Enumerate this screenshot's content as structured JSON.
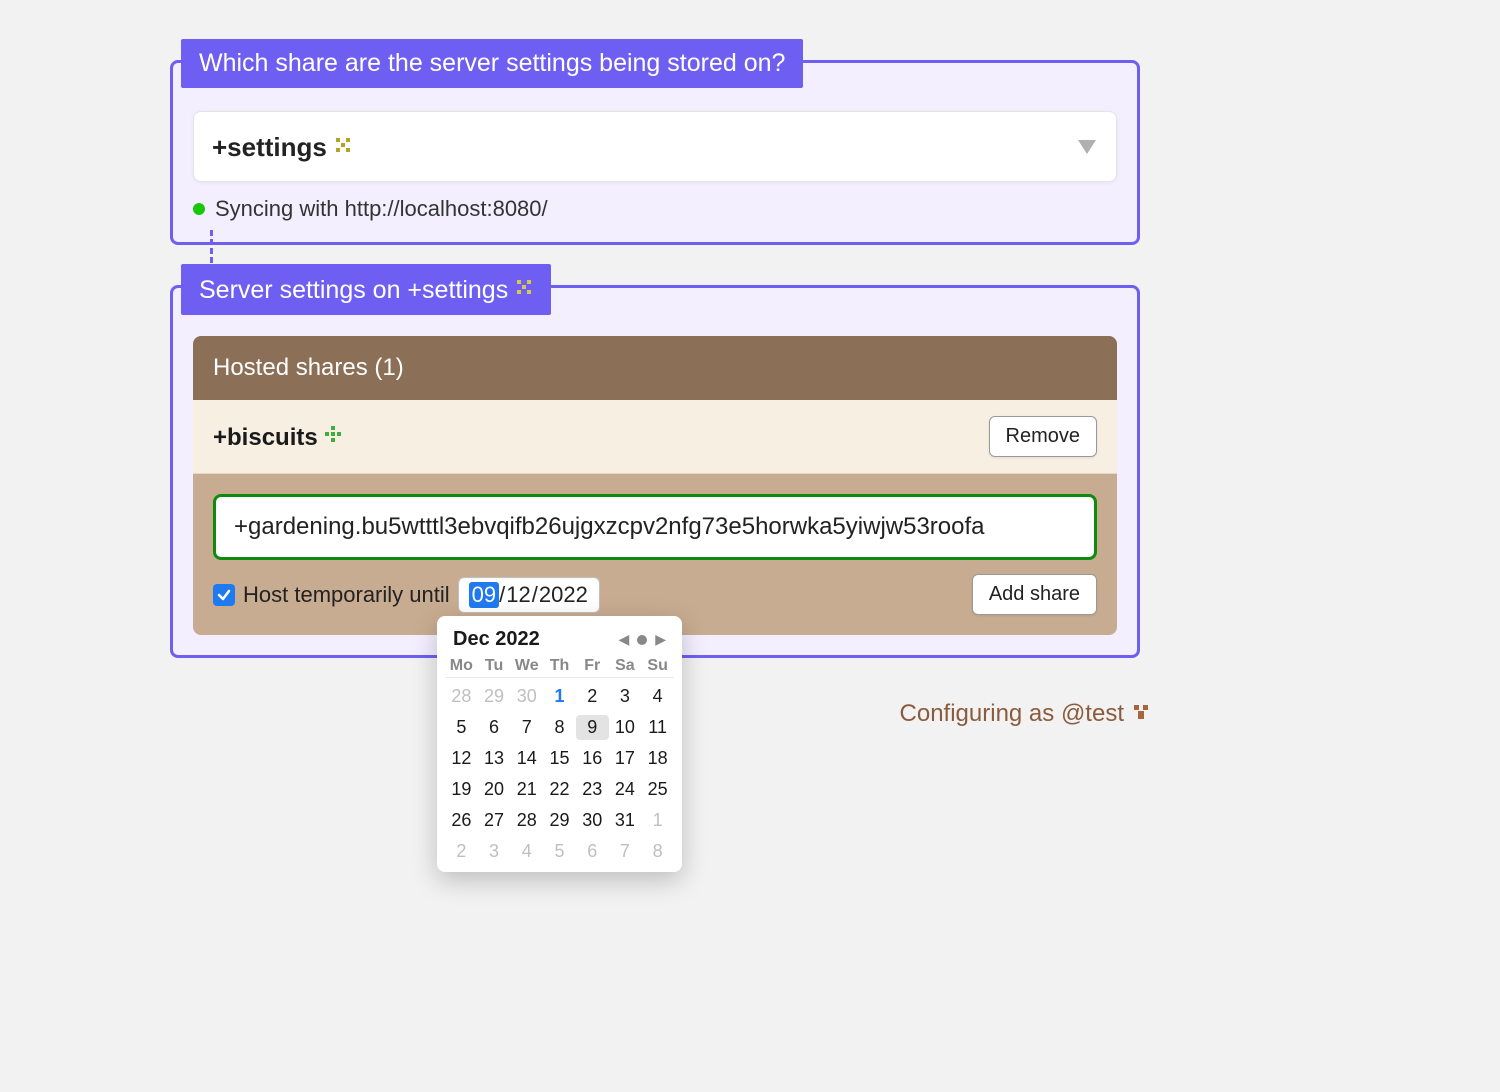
{
  "panel1": {
    "title": "Which share are the server settings being stored on?",
    "selected_share": "+settings",
    "sync_text": "Syncing with http://localhost:8080/"
  },
  "panel2": {
    "title": "Server settings on +settings",
    "hosted_bar": "Hosted shares (1)",
    "item": {
      "name": "+biscuits",
      "remove": "Remove"
    },
    "add_input_value": "+gardening.bu5wtttl3ebvqifb26ujgxzcpv2nfg73e5horwka5yiwjw53roofa",
    "host_temp_label": "Host temporarily until",
    "date": {
      "day": "09",
      "month": "12",
      "year": "2022"
    },
    "add_button": "Add share"
  },
  "calendar": {
    "title": "Dec 2022",
    "dow": [
      "Mo",
      "Tu",
      "We",
      "Th",
      "Fr",
      "Sa",
      "Su"
    ],
    "days": [
      {
        "n": "28",
        "cls": "out"
      },
      {
        "n": "29",
        "cls": "out"
      },
      {
        "n": "30",
        "cls": "out"
      },
      {
        "n": "1",
        "cls": "today"
      },
      {
        "n": "2",
        "cls": ""
      },
      {
        "n": "3",
        "cls": ""
      },
      {
        "n": "4",
        "cls": ""
      },
      {
        "n": "5",
        "cls": ""
      },
      {
        "n": "6",
        "cls": ""
      },
      {
        "n": "7",
        "cls": ""
      },
      {
        "n": "8",
        "cls": ""
      },
      {
        "n": "9",
        "cls": "sel"
      },
      {
        "n": "10",
        "cls": ""
      },
      {
        "n": "11",
        "cls": ""
      },
      {
        "n": "12",
        "cls": ""
      },
      {
        "n": "13",
        "cls": ""
      },
      {
        "n": "14",
        "cls": ""
      },
      {
        "n": "15",
        "cls": ""
      },
      {
        "n": "16",
        "cls": ""
      },
      {
        "n": "17",
        "cls": ""
      },
      {
        "n": "18",
        "cls": ""
      },
      {
        "n": "19",
        "cls": ""
      },
      {
        "n": "20",
        "cls": ""
      },
      {
        "n": "21",
        "cls": ""
      },
      {
        "n": "22",
        "cls": ""
      },
      {
        "n": "23",
        "cls": ""
      },
      {
        "n": "24",
        "cls": ""
      },
      {
        "n": "25",
        "cls": ""
      },
      {
        "n": "26",
        "cls": ""
      },
      {
        "n": "27",
        "cls": ""
      },
      {
        "n": "28",
        "cls": ""
      },
      {
        "n": "29",
        "cls": ""
      },
      {
        "n": "30",
        "cls": ""
      },
      {
        "n": "31",
        "cls": ""
      },
      {
        "n": "1",
        "cls": "out"
      },
      {
        "n": "2",
        "cls": "out"
      },
      {
        "n": "3",
        "cls": "out"
      },
      {
        "n": "4",
        "cls": "out"
      },
      {
        "n": "5",
        "cls": "out"
      },
      {
        "n": "6",
        "cls": "out"
      },
      {
        "n": "7",
        "cls": "out"
      },
      {
        "n": "8",
        "cls": "out"
      }
    ]
  },
  "footer": {
    "text": "Configuring as @test"
  },
  "colors": {
    "accent": "#6e5ff2",
    "green_dot": "#18c60a",
    "blue": "#1f7af0",
    "input_border_green": "#0e8a0e"
  }
}
